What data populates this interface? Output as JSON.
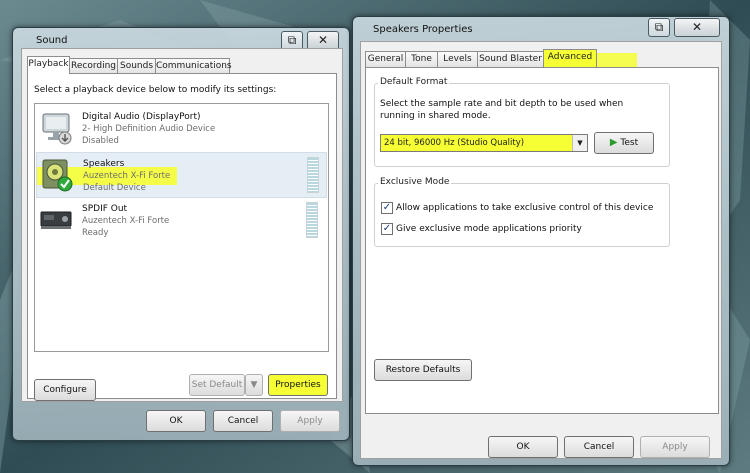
{
  "sound": {
    "title": "Sound",
    "caption_restore": "⧉",
    "caption_close": "✕",
    "tabs": [
      "Playback",
      "Recording",
      "Sounds",
      "Communications"
    ],
    "instruction": "Select a playback device below to modify its settings:",
    "devices": [
      {
        "name": "Digital Audio (DisplayPort)",
        "line2": "2- High Definition Audio Device",
        "line3": "Disabled"
      },
      {
        "name": "Speakers",
        "line2": "Auzentech X-Fi Forte",
        "line3": "Default Device"
      },
      {
        "name": "SPDIF Out",
        "line2": "Auzentech X-Fi Forte",
        "line3": "Ready"
      }
    ],
    "configure": "Configure",
    "set_default": "Set Default",
    "properties": "Properties",
    "ok": "OK",
    "cancel": "Cancel",
    "apply": "Apply"
  },
  "props": {
    "title": "Speakers Properties",
    "caption_restore": "⧉",
    "caption_close": "✕",
    "tabs": [
      "General",
      "Tone",
      "Levels",
      "Sound Blaster",
      "Advanced"
    ],
    "default_format": {
      "title": "Default Format",
      "description": "Select the sample rate and bit depth to be used when running in shared mode.",
      "selected": "24 bit, 96000 Hz (Studio Quality)",
      "test": "Test"
    },
    "exclusive": {
      "title": "Exclusive Mode",
      "option1": "Allow applications to take exclusive control of this device",
      "option2": "Give exclusive mode applications priority",
      "option1_checked": true,
      "option2_checked": true
    },
    "restore_defaults": "Restore Defaults",
    "ok": "OK",
    "cancel": "Cancel",
    "apply": "Apply"
  }
}
